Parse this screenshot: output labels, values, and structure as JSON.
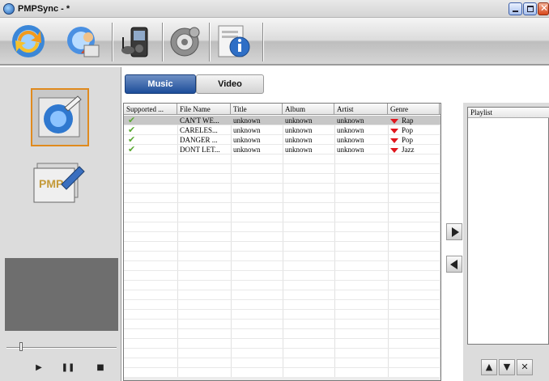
{
  "window": {
    "title": "PMPSync - *"
  },
  "toolbar": {
    "buttons": [
      {
        "icon": "sync-icon"
      },
      {
        "icon": "users-icon"
      },
      {
        "icon": "device-icon"
      },
      {
        "icon": "settings-icon"
      },
      {
        "icon": "info-icon"
      }
    ]
  },
  "tabs": {
    "music": "Music",
    "video": "Video",
    "active": "music"
  },
  "table": {
    "columns": [
      "Supported ...",
      "File Name",
      "Title",
      "Album",
      "Artist",
      "Genre"
    ],
    "rows": [
      {
        "file_name": "CAN'T WE...",
        "title": "unknown",
        "album": "unknown",
        "artist": "unknown",
        "genre": "Rap",
        "selected": true
      },
      {
        "file_name": "CARELES...",
        "title": "unknown",
        "album": "unknown",
        "artist": "unknown",
        "genre": "Pop",
        "selected": false
      },
      {
        "file_name": "DANGER ...",
        "title": "unknown",
        "album": "unknown",
        "artist": "unknown",
        "genre": "Pop",
        "selected": false
      },
      {
        "file_name": "DONT LET...",
        "title": "unknown",
        "album": "unknown",
        "artist": "unknown",
        "genre": "Jazz",
        "selected": false
      }
    ]
  },
  "playlist": {
    "header": "Playlist"
  },
  "player": {
    "play": "▶",
    "pause": "❚❚",
    "stop": "■"
  },
  "colors": {
    "accent_tab": "#1d4d9a",
    "selection": "#c7c7c7",
    "check": "#5aa832",
    "genre_arrow": "#e0161d",
    "active_mode_border": "#e08a1e"
  }
}
